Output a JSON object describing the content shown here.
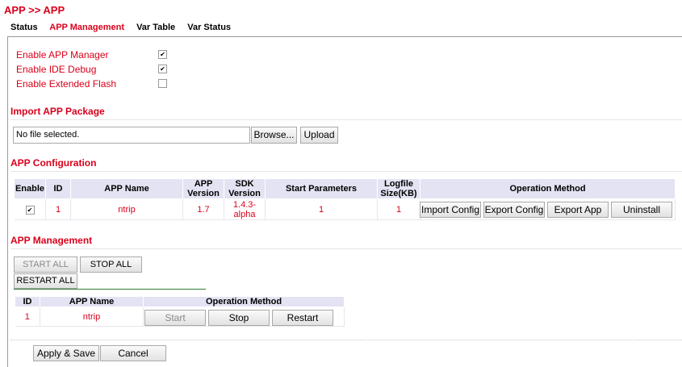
{
  "breadcrumb": "APP >> APP",
  "tabs": [
    {
      "label": "Status",
      "active": false
    },
    {
      "label": "APP Management",
      "active": true
    },
    {
      "label": "Var Table",
      "active": false
    },
    {
      "label": "Var Status",
      "active": false
    }
  ],
  "options": [
    {
      "label": "Enable APP Manager",
      "checked": true
    },
    {
      "label": "Enable IDE Debug",
      "checked": true
    },
    {
      "label": "Enable Extended Flash",
      "checked": false
    }
  ],
  "import": {
    "title": "Import APP Package",
    "file_text": "No file selected.",
    "browse_label": "Browse...",
    "upload_label": "Upload"
  },
  "config": {
    "title": "APP Configuration",
    "headers": {
      "enable": "Enable",
      "id": "ID",
      "name": "APP Name",
      "app_version_1": "APP",
      "app_version_2": "Version",
      "sdk_version_1": "SDK",
      "sdk_version_2": "Version",
      "start_params": "Start Parameters",
      "logfile_1": "Logfile",
      "logfile_2": "Size(KB)",
      "operation": "Operation Method"
    },
    "row": {
      "enabled": true,
      "id": "1",
      "name": "ntrip",
      "app_version": "1.7",
      "sdk_version_1": "1.4.3-",
      "sdk_version_2": "alpha",
      "start_params": "1",
      "logfile_size": "1"
    },
    "buttons": {
      "import_config": "Import Config",
      "export_config": "Export Config",
      "export_app": "Export App",
      "uninstall": "Uninstall"
    }
  },
  "management": {
    "title": "APP Management",
    "start_all": "START ALL",
    "stop_all": "STOP ALL",
    "restart_all": "RESTART ALL",
    "headers": {
      "id": "ID",
      "name": "APP Name",
      "operation": "Operation Method"
    },
    "row": {
      "id": "1",
      "name": "ntrip"
    },
    "buttons": {
      "start": "Start",
      "stop": "Stop",
      "restart": "Restart"
    }
  },
  "footer": {
    "apply_label": "Apply & Save",
    "cancel_label": "Cancel"
  },
  "colors": {
    "accent": "#d9001b",
    "table_header": "#e3e3f3"
  }
}
